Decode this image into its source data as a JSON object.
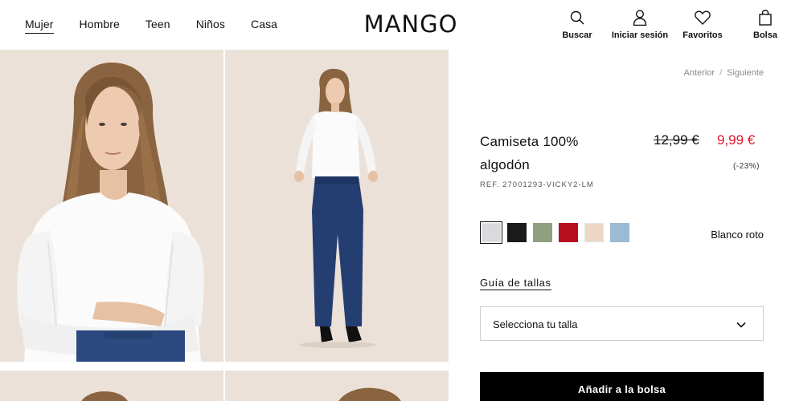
{
  "header": {
    "logo": "MANGO",
    "nav": [
      "Mujer",
      "Hombre",
      "Teen",
      "Niños",
      "Casa"
    ],
    "actions": [
      {
        "label": "Buscar",
        "icon": "search-icon"
      },
      {
        "label": "Iniciar sesión",
        "icon": "user-icon"
      },
      {
        "label": "Favoritos",
        "icon": "heart-icon"
      },
      {
        "label": "Bolsa",
        "icon": "bag-icon"
      }
    ]
  },
  "product": {
    "pager_prev": "Anterior",
    "pager_sep": "/",
    "pager_next": "Siguiente",
    "title": "Camiseta 100% algodón",
    "price_old": "12,99 €",
    "price_new": "9,99 €",
    "discount": "(-23%)",
    "ref": "REF. 27001293-VICKY2-LM",
    "colors": [
      {
        "name": "Blanco roto",
        "hex": "#d9d9df",
        "selected": true
      },
      {
        "name": "negro",
        "hex": "#1a1a1a"
      },
      {
        "name": "verde",
        "hex": "#8f9f7f"
      },
      {
        "name": "rojo",
        "hex": "#b50f1f"
      },
      {
        "name": "beige",
        "hex": "#ecd6c6"
      },
      {
        "name": "azul",
        "hex": "#9bbad4"
      }
    ],
    "selected_color": "Blanco roto",
    "size_guide": "Guía de tallas",
    "size_select": "Selecciona tu talla",
    "add_to_bag": "Añadir a la bolsa"
  },
  "colors": {
    "price_sale": "#e0162b",
    "photo_bg": "#ebe1d8",
    "button_bg": "#000000"
  }
}
